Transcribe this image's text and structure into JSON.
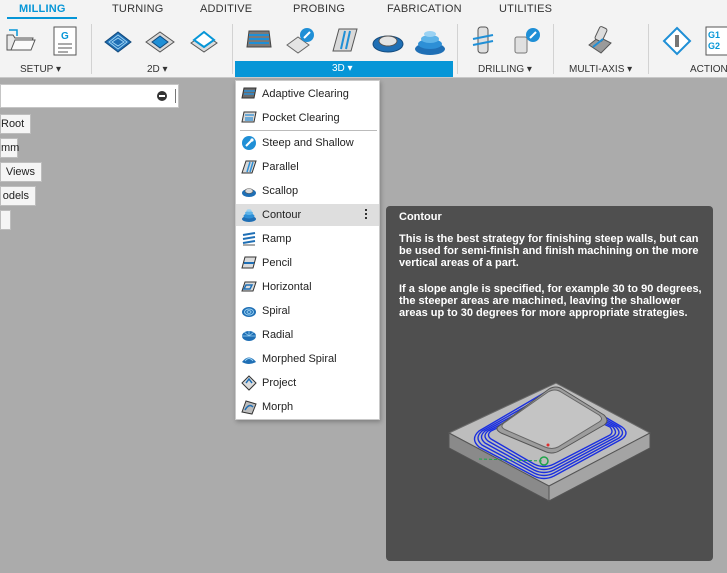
{
  "ribbon": {
    "tabs": [
      {
        "label": "MILLING",
        "active": true
      },
      {
        "label": "TURNING"
      },
      {
        "label": "ADDITIVE"
      },
      {
        "label": "PROBING"
      },
      {
        "label": "FABRICATION"
      },
      {
        "label": "UTILITIES"
      }
    ],
    "groups": {
      "setup": "SETUP ▾",
      "two_d": "2D ▾",
      "three_d": "3D ▾",
      "drilling": "DRILLING ▾",
      "multi_axis": "MULTI-AXIS ▾",
      "actions": "ACTION"
    },
    "gcode_badge_top": "G",
    "gcode_badge_right": "G1\nG2",
    "accent": "#0696d7"
  },
  "browser": {
    "items": [
      "Root",
      "mm",
      "Views",
      "odels",
      ""
    ]
  },
  "menu": {
    "items": [
      {
        "label": "Adaptive Clearing",
        "icon": "adaptive-clearing-icon"
      },
      {
        "label": "Pocket Clearing",
        "icon": "pocket-clearing-icon"
      },
      {
        "label": "Steep and Shallow",
        "icon": "steep-shallow-icon"
      },
      {
        "label": "Parallel",
        "icon": "parallel-icon"
      },
      {
        "label": "Scallop",
        "icon": "scallop-icon"
      },
      {
        "label": "Contour",
        "icon": "contour-icon",
        "hover": true
      },
      {
        "label": "Ramp",
        "icon": "ramp-icon"
      },
      {
        "label": "Pencil",
        "icon": "pencil-icon"
      },
      {
        "label": "Horizontal",
        "icon": "horizontal-icon"
      },
      {
        "label": "Spiral",
        "icon": "spiral-icon"
      },
      {
        "label": "Radial",
        "icon": "radial-icon"
      },
      {
        "label": "Morphed Spiral",
        "icon": "morphed-spiral-icon"
      },
      {
        "label": "Project",
        "icon": "project-icon"
      },
      {
        "label": "Morph",
        "icon": "morph-icon"
      }
    ]
  },
  "tooltip": {
    "title": "Contour",
    "paragraphs": [
      "This is the best strategy for finishing steep walls, but can be used for semi-finish and finish machining on the more vertical areas of a part.",
      "If a slope angle is specified, for example 30 to 90 degrees, the steeper areas are machined, leaving the shallower areas up to 30 degrees for more appropriate strategies."
    ]
  }
}
